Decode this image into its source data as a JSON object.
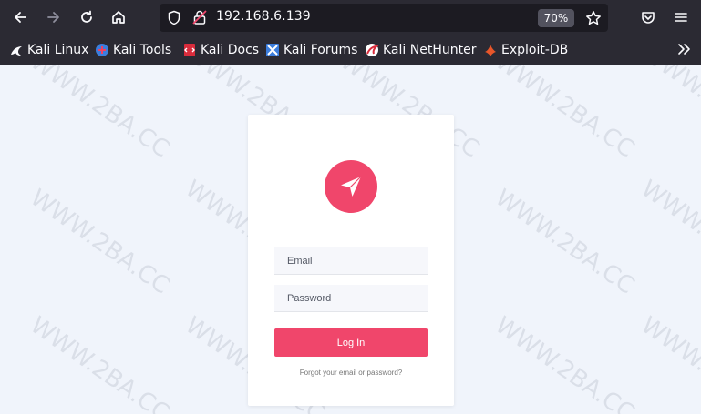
{
  "browser": {
    "url": "192.168.6.139",
    "zoom": "70%",
    "colors": {
      "chrome_bg": "#2b2a33",
      "urlbar_bg": "#1c1b22",
      "accent": "#f0466b"
    }
  },
  "bookmarks": [
    {
      "label": "Kali Linux",
      "icon": "kali-dragon-icon"
    },
    {
      "label": "Kali Tools",
      "icon": "kali-tools-icon"
    },
    {
      "label": "Kali Docs",
      "icon": "kali-docs-icon"
    },
    {
      "label": "Kali Forums",
      "icon": "kali-forums-icon"
    },
    {
      "label": "Kali NetHunter",
      "icon": "kali-nethunter-icon"
    },
    {
      "label": "Exploit-DB",
      "icon": "exploit-db-icon"
    }
  ],
  "login": {
    "logo_icon": "paper-plane-icon",
    "email_placeholder": "Email",
    "password_placeholder": "Password",
    "submit_label": "Log In",
    "forgot_link": "Forgot your email or password?"
  },
  "watermark": {
    "text": "WWW.2BA.CC"
  }
}
